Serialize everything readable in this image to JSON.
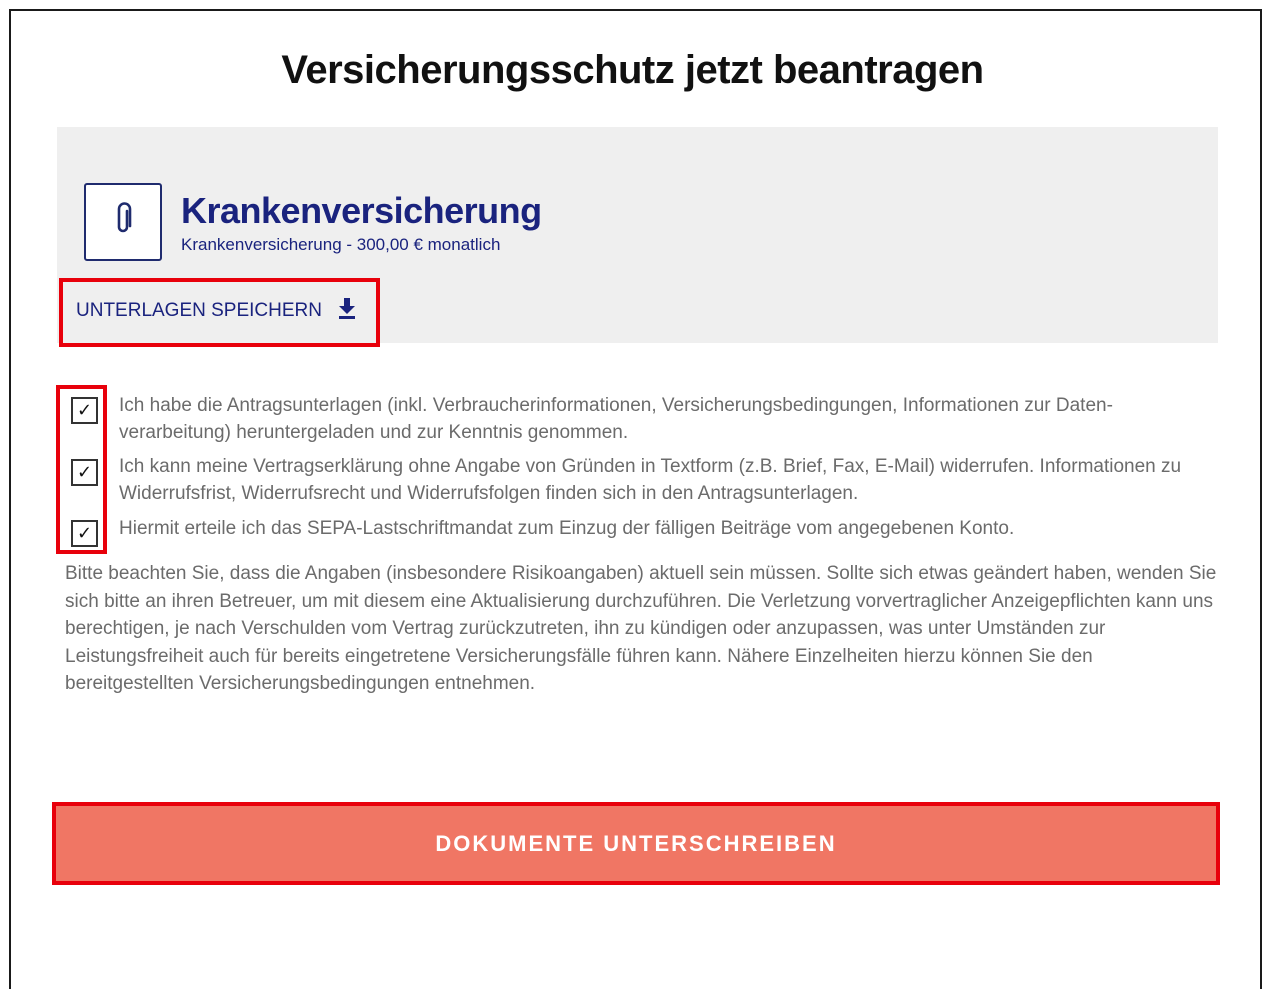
{
  "page": {
    "title": "Versicherungsschutz jetzt beantragen"
  },
  "product": {
    "icon": "paperclip-icon",
    "name": "Krankenversicherung",
    "subtitle": "Krankenversicherung - 300,00 € monatlich",
    "save_label": "UNTERLAGEN SPEICHERN",
    "save_icon": "download-icon"
  },
  "consents": [
    {
      "checked": true,
      "mark": "✓",
      "text": "Ich habe die Antragsunterlagen (inkl. Verbraucherinformationen, Versicherungsbedingungen, Informationen zur Daten-verarbeitung) heruntergeladen und zur Kenntnis genommen."
    },
    {
      "checked": true,
      "mark": "✓",
      "text": "Ich kann meine Vertragserklärung ohne Angabe von Gründen in Textform (z.B. Brief, Fax, E-Mail) widerrufen. Informationen zu Widerrufsfrist, Widerrufsrecht und Widerrufsfolgen finden sich in den Antragsunterlagen."
    },
    {
      "checked": true,
      "mark": "✓",
      "text": "Hiermit erteile ich das SEPA-Lastschriftmandat zum Einzug der fälligen Beiträge vom angegebenen Konto."
    }
  ],
  "notice": "Bitte beachten Sie, dass die Angaben (insbesondere Risikoangaben) aktuell sein müssen. Sollte sich etwas geändert haben, wenden Sie sich bitte an ihren Betreuer, um mit diesem eine Aktualisierung durchzuführen. Die Verletzung vorvertraglicher Anzeigepflichten kann uns berechtigen, je nach Verschulden vom Vertrag zurückzutreten, ihn zu kündigen oder anzupassen, was unter Umständen zur Leistungsfreiheit auch für bereits eingetretene Versicherungsfälle führen kann. Nähere Einzelheiten hierzu können Sie den bereitgestellten Versicherungsbedingungen entnehmen.",
  "sign_button": "DOKUMENTE UNTERSCHREIBEN",
  "colors": {
    "brand_navy": "#1a237e",
    "highlight_red": "#e8000b",
    "cta_salmon": "#f07664",
    "panel_gray": "#efefef",
    "text_gray": "#6b6b6b"
  }
}
